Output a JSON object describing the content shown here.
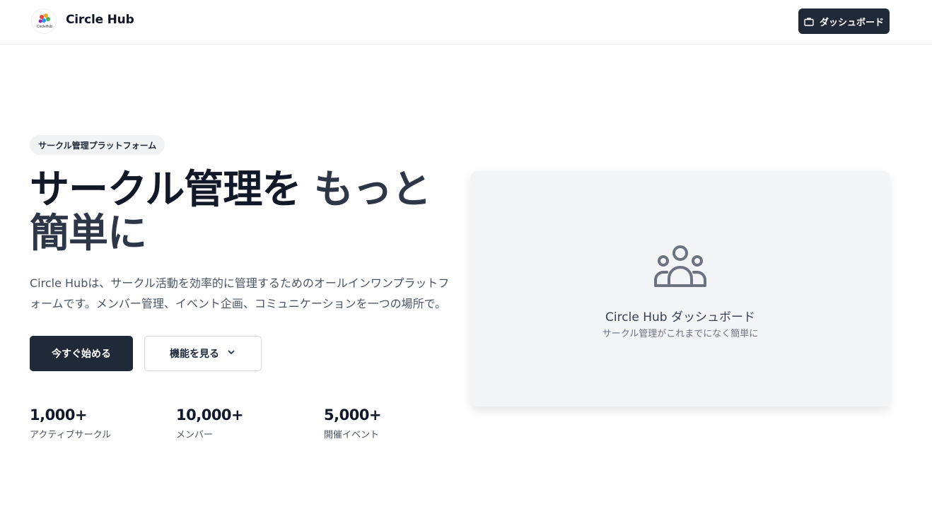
{
  "header": {
    "brand": "Circle Hub",
    "logo_text": "CircleHub",
    "dashboard_button": "ダッシュボード"
  },
  "hero": {
    "badge": "サークル管理プラットフォーム",
    "headline_part1": "サークル管理を",
    "headline_part2": "もっと簡単に",
    "description": "Circle Hubは、サークル活動を効率的に管理するためのオールインワンプラットフォームです。メンバー管理、イベント企画、コミュニケーションを一つの場所で。",
    "primary_button": "今すぐ始める",
    "secondary_button": "機能を見る"
  },
  "stats": [
    {
      "value": "1,000+",
      "label": "アクティブサークル"
    },
    {
      "value": "10,000+",
      "label": "メンバー"
    },
    {
      "value": "5,000+",
      "label": "開催イベント"
    }
  ],
  "preview_card": {
    "title": "Circle Hub ダッシュボード",
    "subtitle": "サークル管理がこれまでになく簡単に"
  },
  "icons": {
    "briefcase": "briefcase-icon",
    "chevron": "chevron-down-icon",
    "users": "users-icon"
  },
  "colors": {
    "primary": "#1f2937",
    "card_bg": "#f3f4f6"
  }
}
